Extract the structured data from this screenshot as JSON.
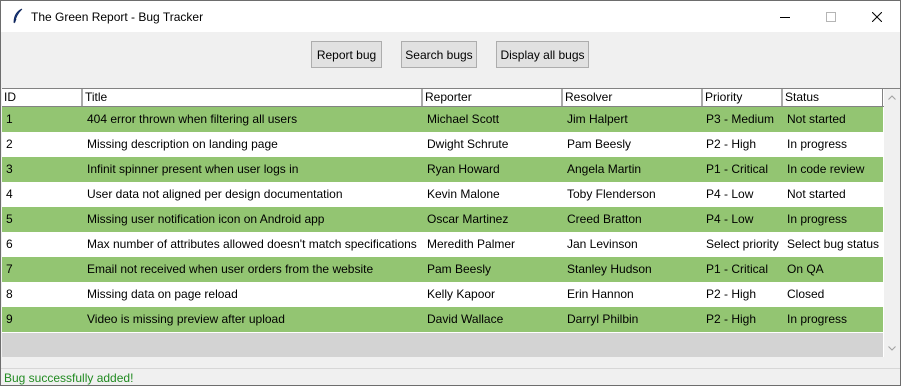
{
  "window": {
    "title": "The Green Report - Bug Tracker",
    "app_icon": "feather-icon",
    "controls": {
      "minimize": "minimize-icon",
      "maximize": "maximize-icon",
      "close": "close-icon"
    }
  },
  "toolbar": {
    "report_bug": "Report bug",
    "search_bugs": "Search bugs",
    "display_all_bugs": "Display all bugs"
  },
  "table": {
    "columns": {
      "id": "ID",
      "title": "Title",
      "reporter": "Reporter",
      "resolver": "Resolver",
      "priority": "Priority",
      "status": "Status"
    },
    "rows": [
      {
        "id": "1",
        "title": "404 error thrown when filtering all users",
        "reporter": "Michael Scott",
        "resolver": "Jim Halpert",
        "priority": "P3 - Medium",
        "status": "Not started"
      },
      {
        "id": "2",
        "title": "Missing description on landing page",
        "reporter": "Dwight Schrute",
        "resolver": "Pam Beesly",
        "priority": "P2 - High",
        "status": "In progress"
      },
      {
        "id": "3",
        "title": "Infinit spinner present when user logs in",
        "reporter": "Ryan Howard",
        "resolver": "Angela Martin",
        "priority": "P1 - Critical",
        "status": "In code review"
      },
      {
        "id": "4",
        "title": "User data not aligned per design documentation",
        "reporter": "Kevin Malone",
        "resolver": "Toby Flenderson",
        "priority": "P4 - Low",
        "status": "Not started"
      },
      {
        "id": "5",
        "title": "Missing user notification icon on Android app",
        "reporter": "Oscar Martinez",
        "resolver": "Creed Bratton",
        "priority": "P4 - Low",
        "status": "In progress"
      },
      {
        "id": "6",
        "title": "Max number of attributes allowed doesn't match specifications",
        "reporter": "Meredith Palmer",
        "resolver": "Jan Levinson",
        "priority": "Select priority",
        "status": "Select bug status"
      },
      {
        "id": "7",
        "title": "Email not received when user orders from the website",
        "reporter": "Pam Beesly",
        "resolver": "Stanley Hudson",
        "priority": "P1 - Critical",
        "status": "On QA"
      },
      {
        "id": "8",
        "title": "Missing data on page reload",
        "reporter": "Kelly Kapoor",
        "resolver": "Erin Hannon",
        "priority": "P2 - High",
        "status": "Closed"
      },
      {
        "id": "9",
        "title": "Video is missing preview after upload",
        "reporter": "David Wallace",
        "resolver": "Darryl Philbin",
        "priority": "P2 - High",
        "status": "In progress"
      }
    ],
    "row_colors": {
      "odd": "#93c572",
      "even": "#ffffff"
    }
  },
  "statusbar": {
    "message": "Bug successfully added!",
    "color": "#228b22"
  }
}
